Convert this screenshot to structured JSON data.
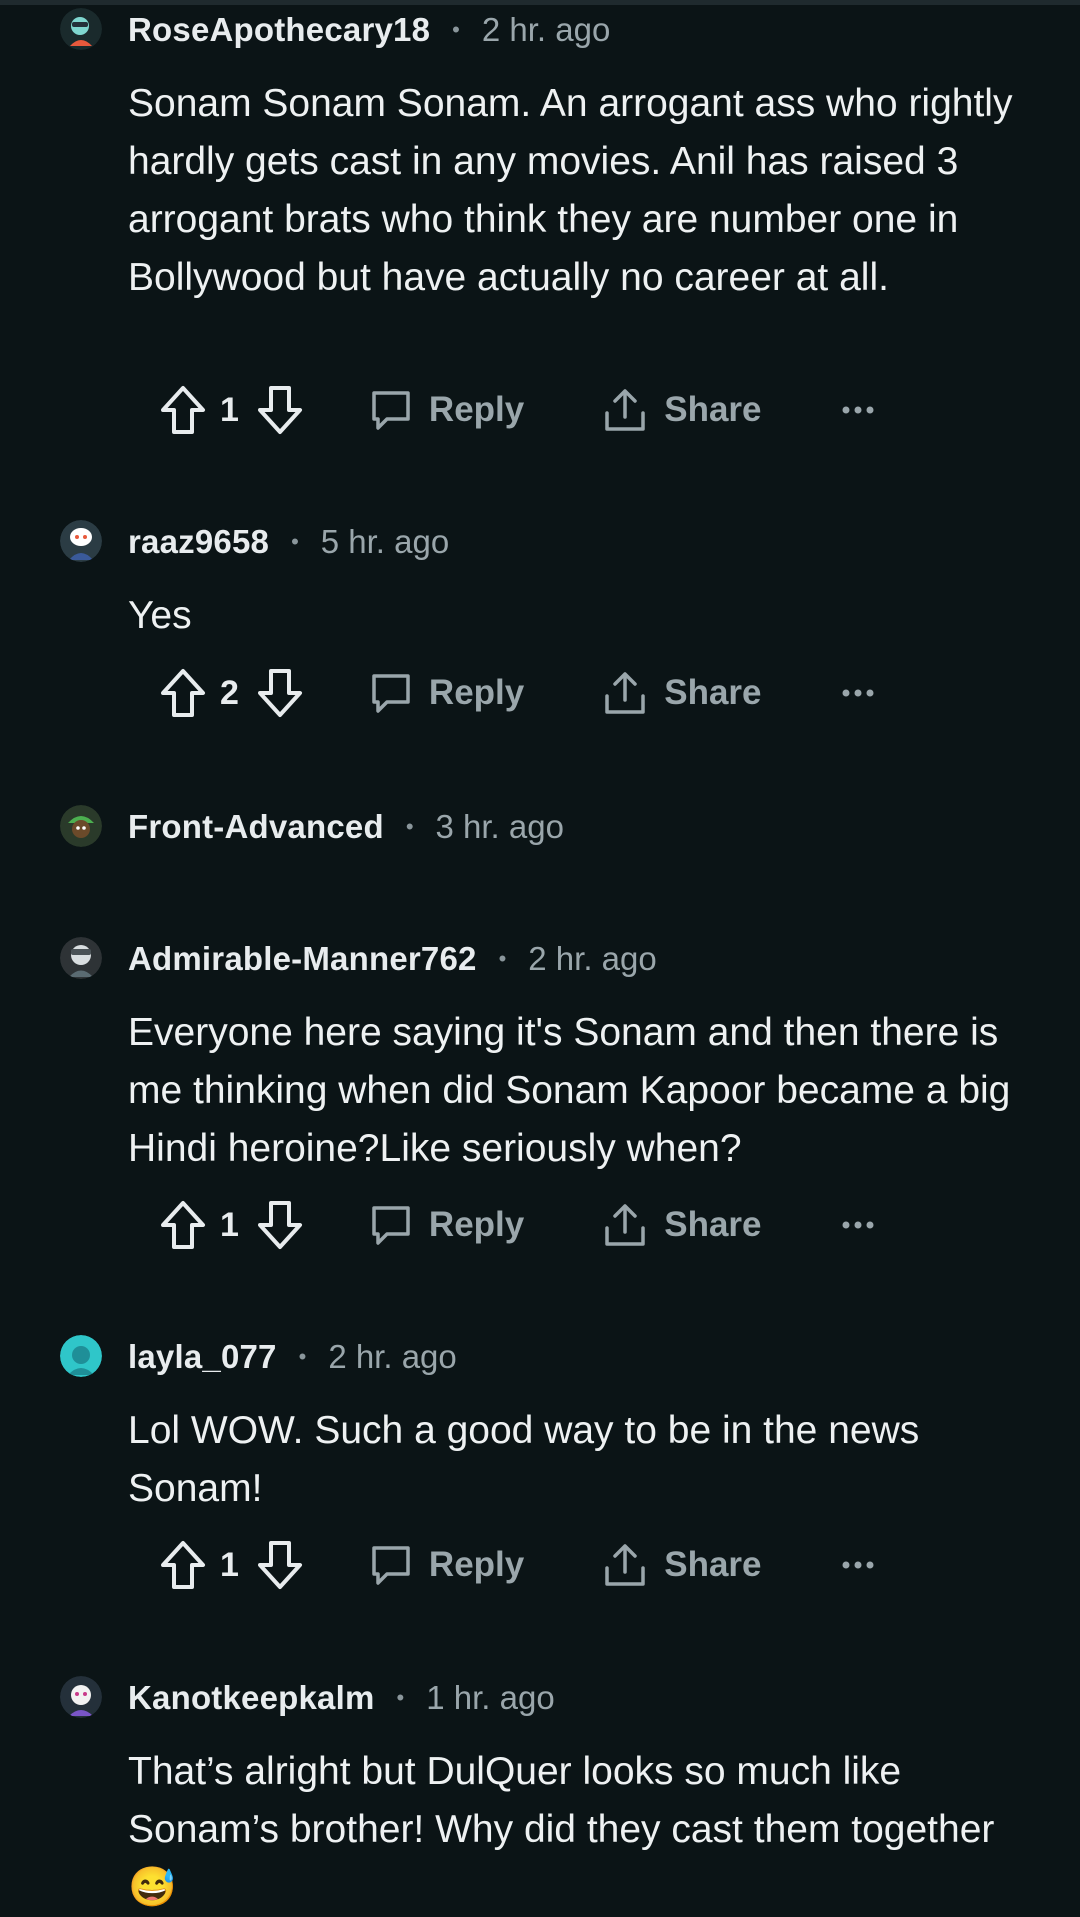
{
  "comments": [
    {
      "username": "RoseApothecary18",
      "time": "2 hr. ago",
      "body": "Sonam Sonam Sonam. An arrogant ass who rightly hardly gets cast in any movies. Anil has raised 3 arrogant brats who think they are number one in Bollywood but have actually no career at all.",
      "score": "1",
      "avatar": "avatar-rose",
      "avatar_color": "#1a2a2c"
    },
    {
      "username": "raaz9658",
      "time": "5 hr. ago",
      "body": "Yes",
      "score": "2",
      "avatar": "avatar-raaz",
      "avatar_color": "#2b3c44"
    },
    {
      "username": "Front-Advanced",
      "time": "3 hr. ago",
      "avatar": "avatar-front",
      "avatar_color": "#2a3a2a"
    },
    {
      "username": "Admirable-Manner762",
      "time": "2 hr. ago",
      "body": "Everyone here saying it's Sonam and then there is me thinking when did Sonam Kapoor became a big Hindi heroine?Like seriously when?",
      "score": "1",
      "avatar": "avatar-admirable",
      "avatar_color": "#2e3336"
    },
    {
      "username": "layla_077",
      "time": "2 hr. ago",
      "body": "Lol WOW. Such a good way to be in the news Sonam!",
      "score": "1",
      "avatar": "avatar-layla",
      "avatar_color": "#2fc6c9"
    },
    {
      "username": "Kanotkeepkalm",
      "time": "1 hr. ago",
      "body": "That’s alright but DulQuer looks so much like Sonam’s brother! Why did they cast them together 😅",
      "avatar": "avatar-kanot",
      "avatar_color": "#24303a"
    }
  ],
  "actions": {
    "reply_label": "Reply",
    "share_label": "Share",
    "more_label": "···"
  },
  "colors": {
    "background": "#0b1416",
    "meta_text": "#9aa6ab",
    "body_text": "#eef1f2"
  },
  "icons": [
    "upvote-icon",
    "downvote-icon",
    "comment-bubble-icon",
    "share-icon",
    "more-options-icon"
  ]
}
